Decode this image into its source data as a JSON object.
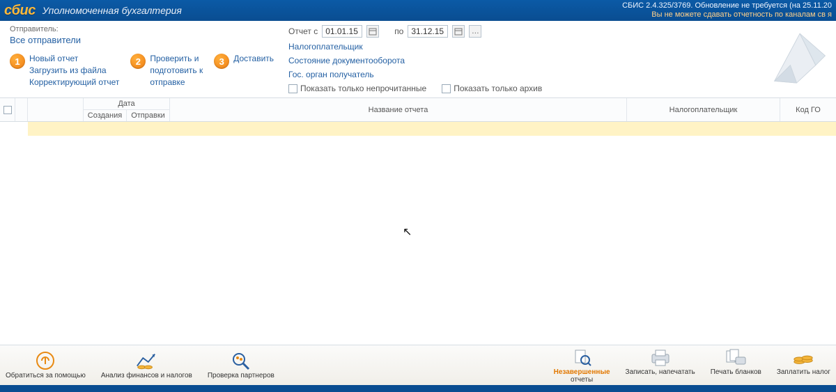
{
  "header": {
    "logo": "сбис",
    "title": "Уполномоченная бухгалтерия",
    "version": "СБИС 2.4.325/3769. Обновление не требуется (на 25.11.20",
    "warn": "Вы не можете сдавать отчетность по каналам св я"
  },
  "sender": {
    "label": "Отправитель:",
    "value": "Все отправители"
  },
  "steps": {
    "s1": {
      "num": "1",
      "a": "Новый отчет",
      "b": "Загрузить из файла",
      "c": "Корректирующий отчет"
    },
    "s2": {
      "num": "2",
      "a": "Проверить и",
      "b": "подготовить к",
      "c": "отправке"
    },
    "s3": {
      "num": "3",
      "a": "Доставить"
    }
  },
  "period": {
    "from_label": "Отчет с",
    "from_value": "01.01.15",
    "to_label": "по",
    "to_value": "31.12.15"
  },
  "filters": {
    "f1": "Налогоплательщик",
    "f2": "Состояние документооборота",
    "f3": "Гос. орган получатель",
    "chk1": "Показать только непрочитанные",
    "chk2": "Показать только архив"
  },
  "table": {
    "date": "Дата",
    "created": "Создания",
    "sent": "Отправки",
    "name": "Название отчета",
    "payer": "Налогоплательщик",
    "code": "Код ГО"
  },
  "toolbar": {
    "t1": "Обратиться за помощью",
    "t2": "Анализ финансов и налогов",
    "t3": "Проверка партнеров",
    "t4a": "Незавершенные",
    "t4b": "отчеты",
    "t5": "Записать, напечатать",
    "t6": "Печать бланков",
    "t7": "Заплатить налог"
  }
}
